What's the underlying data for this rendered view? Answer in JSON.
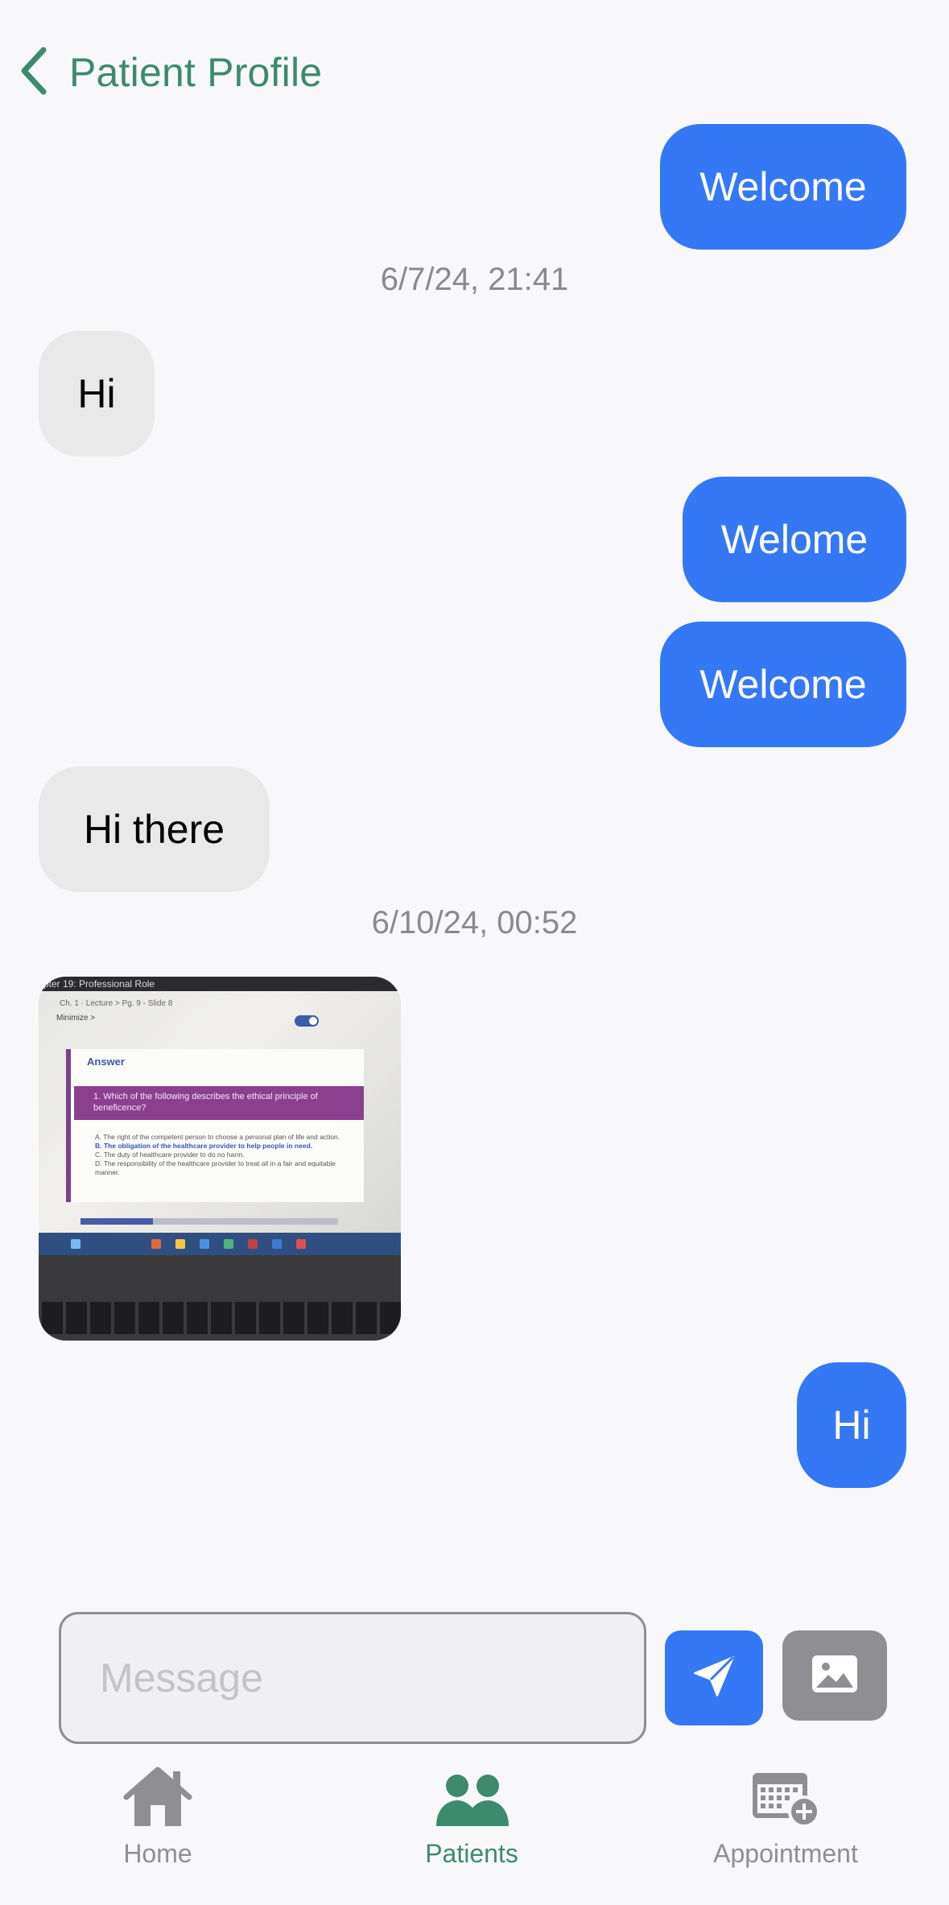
{
  "header": {
    "back_label": "Patient Profile"
  },
  "messages": [
    {
      "type": "text",
      "direction": "outgoing",
      "text": "Welcome"
    },
    {
      "type": "timestamp",
      "text": "6/7/24, 21:41"
    },
    {
      "type": "text",
      "direction": "incoming",
      "text": "Hi"
    },
    {
      "type": "text",
      "direction": "outgoing",
      "text": "Welome"
    },
    {
      "type": "text",
      "direction": "outgoing",
      "text": "Welcome"
    },
    {
      "type": "text",
      "direction": "incoming",
      "text": "Hi there"
    },
    {
      "type": "timestamp",
      "text": "6/10/24, 00:52"
    },
    {
      "type": "image",
      "direction": "incoming",
      "photo": {
        "top_bar": "pter 19: Professional Role",
        "breadcrumb": "Ch. 1 · Lecture  >  Pg. 9 - Slide 8",
        "minimize": "Minimize >",
        "answer_heading": "Answer",
        "question": "1. Which of the following describes the ethical principle of beneficence?",
        "options": [
          "A. The right of the competent person to choose a personal plan of life and action.",
          "B. The obligation of the healthcare provider to help people in need.",
          "C. The duty of healthcare provider to do no harm.",
          "D. The responsibility of the healthcare provider to treat all in a fair and equitable manner."
        ]
      }
    },
    {
      "type": "text",
      "direction": "outgoing",
      "text": "Hi"
    }
  ],
  "composer": {
    "placeholder": "Message",
    "value": ""
  },
  "tabs": [
    {
      "label": "Home",
      "icon": "house-icon",
      "active": false
    },
    {
      "label": "Patients",
      "icon": "people-icon",
      "active": true
    },
    {
      "label": "Appointment",
      "icon": "calendar-add-icon",
      "active": false
    }
  ],
  "colors": {
    "outgoing_bubble": "#3478f6",
    "incoming_bubble": "#e9e9ea",
    "accent_green": "#3d8a6d",
    "inactive_gray": "#8e8e93"
  }
}
